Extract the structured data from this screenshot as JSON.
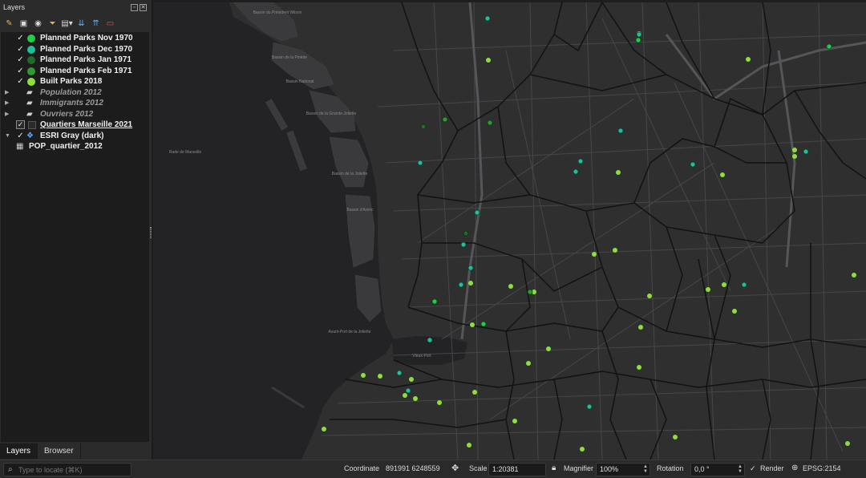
{
  "panel": {
    "title": "Layers",
    "toolbar_icons": [
      "open-layer-styling-icon",
      "add-group-icon",
      "manage-map-themes-icon",
      "filter-legend-icon",
      "filter-by-expression-icon",
      "expand-all-icon",
      "collapse-all-icon",
      "remove-layer-icon"
    ]
  },
  "layers": [
    {
      "label": "Planned Parks Nov 1970",
      "color": "#22cc44",
      "checked": true,
      "style": "bold"
    },
    {
      "label": "Planned Parks Dec 1970",
      "color": "#1fbf9a",
      "checked": true,
      "style": "bold"
    },
    {
      "label": "Planned Parks Jan 1971",
      "color": "#1e6b2a",
      "checked": true,
      "style": "bold"
    },
    {
      "label": "Planned Parks Feb 1971",
      "color": "#2f9a2f",
      "checked": true,
      "style": "bold"
    },
    {
      "label": "Built Parks 2018",
      "color": "#8de03a",
      "checked": true,
      "style": "bold"
    },
    {
      "label": "Population 2012",
      "checked": false,
      "style": "italic"
    },
    {
      "label": "Immigrants 2012",
      "checked": false,
      "style": "italic"
    },
    {
      "label": "Ouvriers 2012",
      "checked": false,
      "style": "italic"
    },
    {
      "label": "Quartiers Marseille 2021",
      "checked": true,
      "style": "underline"
    },
    {
      "label": "ESRI Gray (dark)",
      "checked": true,
      "style": "bold"
    },
    {
      "label": "POP_quartier_2012",
      "style": "table"
    }
  ],
  "tabs": [
    "Layers",
    "Browser"
  ],
  "status": {
    "locate_placeholder": "Type to locate (⌘K)",
    "coordinate_label": "Coordinate",
    "coordinate_value": "891991  6248559",
    "scale_label": "Scale",
    "scale_value": "1:20381",
    "magnifier_label": "Magnifier",
    "magnifier_value": "100%",
    "rotation_label": "Rotation",
    "rotation_value": "0,0 °",
    "render_label": "Render",
    "crs_label": "EPSG:2154"
  },
  "map": {
    "labels": [
      "Bassin du Président Wilson",
      "Bassin de la Pinède",
      "Bassin National",
      "Bassin de la Grande Joliette",
      "Bassin de la Joliette",
      "Bassin d'Arenc",
      "Rade de Marseille",
      "Avant-Port de la Joliette",
      "Vieux-Port"
    ],
    "colors": {
      "background": "#2f2f30",
      "sea": "#232326",
      "roads": "#4a4a4c",
      "boundaries": "#151515"
    }
  }
}
